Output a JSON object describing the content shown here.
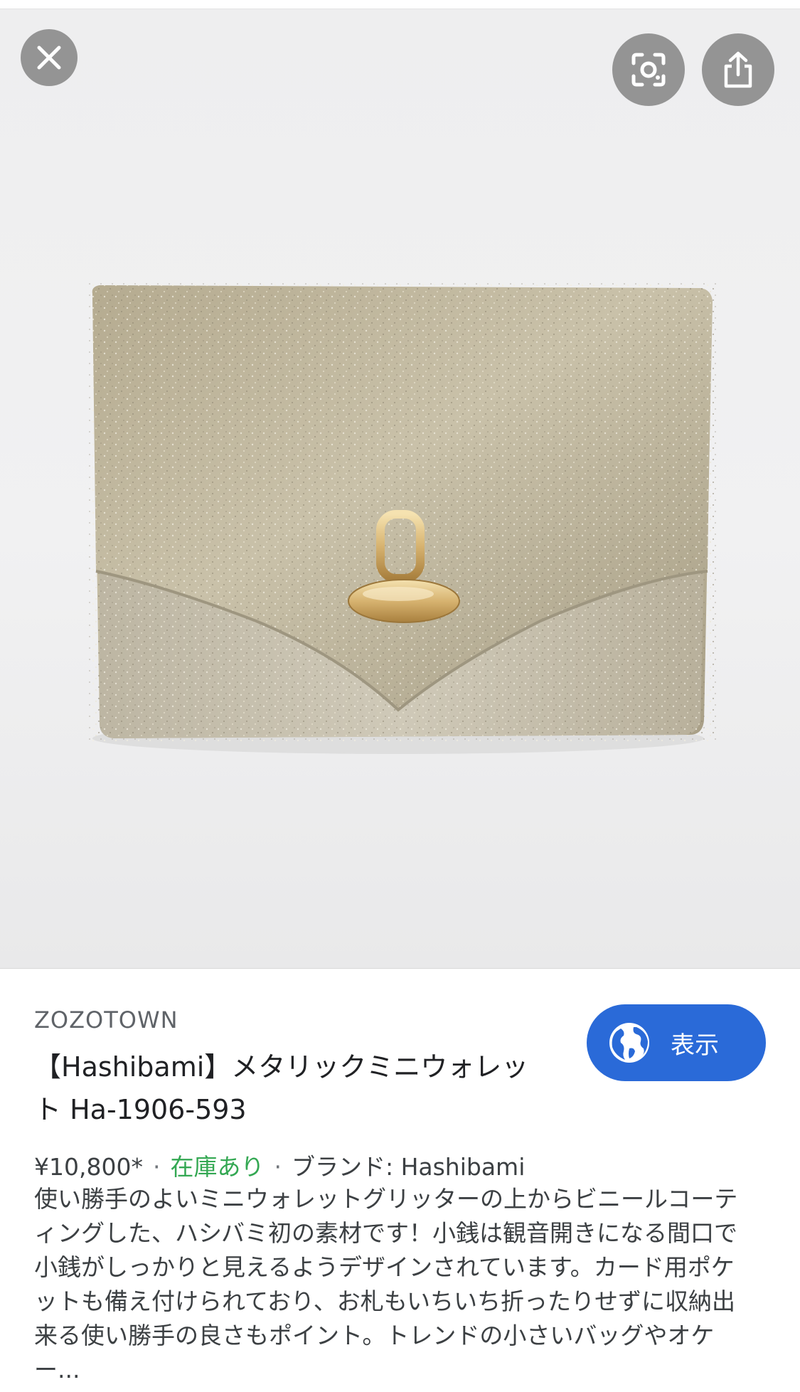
{
  "overlay": {
    "close_icon": "close-icon",
    "lens_icon": "lens-icon",
    "share_icon": "share-icon"
  },
  "product_image": {
    "alt": "glitter gold mini wallet with gold clasp"
  },
  "result": {
    "source": "ZOZOTOWN",
    "title": "【Hashibami】メタリックミニウォレット Ha-1906-593",
    "price": "¥10,800*",
    "separator": "·",
    "stock": "在庫あり",
    "brand": "ブランド: Hashibami",
    "description": "使い勝手のよいミニウォレットグリッターの上からビニールコーティングした、ハシバミ初の素材です！小銭は観音開きになる間口で小銭がしっかりと見えるようデザインされています。カード用ポケットも備え付けられており、お札もいちいち折ったりせずに収納出来る使い勝手の良さもポイント。トレンドの小さいバッグやオケー..."
  },
  "visit_button": {
    "label": "表示",
    "icon": "globe-icon"
  },
  "colors": {
    "accent": "#2a6ad8",
    "stock": "#34a853",
    "text": "#202124",
    "secondary": "#5f6368"
  }
}
